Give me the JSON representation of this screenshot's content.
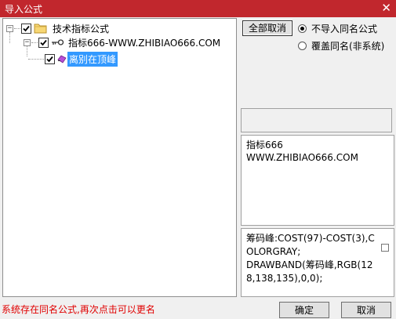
{
  "window": {
    "title": "导入公式",
    "close_glyph": "✕"
  },
  "tree": {
    "root": {
      "label": "技术指标公式",
      "checked": true,
      "expander": "−"
    },
    "formula": {
      "label": "指标666-WWW.ZHIBIAO666.COM",
      "checked": true,
      "expander": "−"
    },
    "item": {
      "label": "离别在顶峰",
      "checked": true,
      "selected": true
    }
  },
  "buttons": {
    "deselect_all": "全部取消",
    "ok": "确定",
    "cancel": "取消"
  },
  "options": {
    "no_import_same": "不导入同名公式",
    "overwrite_same": "覆盖同名(非系统)",
    "selected": "no_import_same"
  },
  "info": {
    "line1": "指标666",
    "line2": "WWW.ZHIBIAO666.COM"
  },
  "code": {
    "text": "筹码峰:COST(97)-COST(3),COLORGRAY;\nDRAWBAND(筹码峰,RGB(128,138,135),0,0);"
  },
  "status": {
    "message": "系统存在同名公式,再次点击可以更名"
  },
  "colors": {
    "titlebar": "#c1272d",
    "selection": "#3399ff",
    "status_text": "#e00000"
  }
}
